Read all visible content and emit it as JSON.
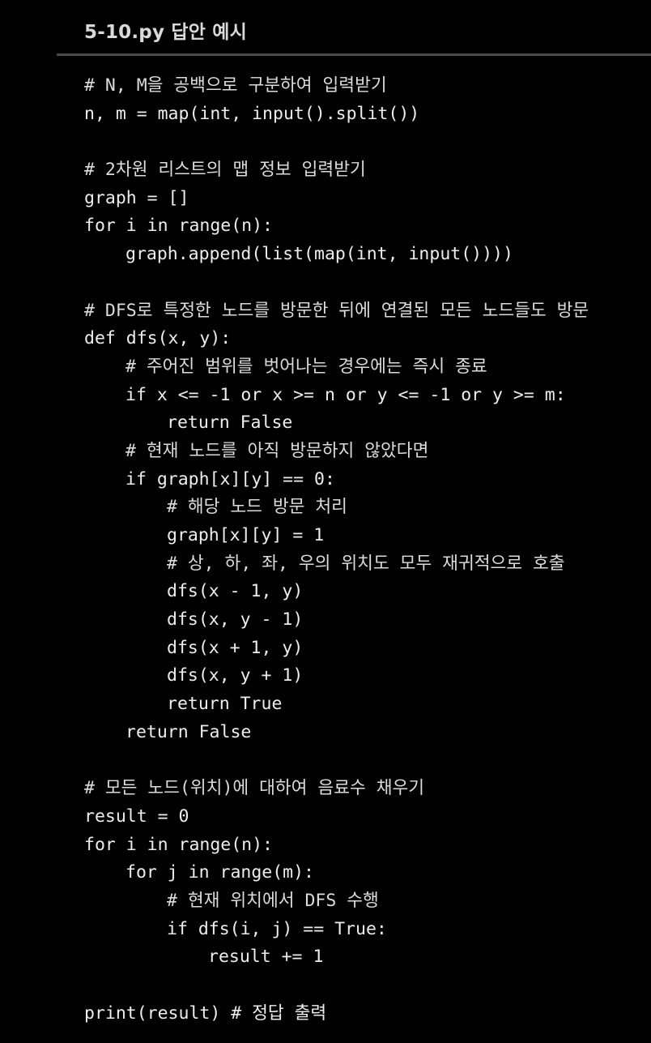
{
  "header": {
    "title": "5-10.py 답안 예시"
  },
  "code": {
    "lines": [
      {
        "indent": 0,
        "text": "# N, M을 공백으로 구분하여 입력받기"
      },
      {
        "indent": 0,
        "text": "n, m = map(int, input().split())"
      },
      {
        "indent": 0,
        "text": ""
      },
      {
        "indent": 0,
        "text": "# 2차원 리스트의 맵 정보 입력받기"
      },
      {
        "indent": 0,
        "text": "graph = []"
      },
      {
        "indent": 0,
        "text": "for i in range(n):"
      },
      {
        "indent": 1,
        "text": "graph.append(list(map(int, input())))"
      },
      {
        "indent": 0,
        "text": ""
      },
      {
        "indent": 0,
        "text": "# DFS로 특정한 노드를 방문한 뒤에 연결된 모든 노드들도 방문"
      },
      {
        "indent": 0,
        "text": "def dfs(x, y):"
      },
      {
        "indent": 1,
        "text": "# 주어진 범위를 벗어나는 경우에는 즉시 종료"
      },
      {
        "indent": 1,
        "text": "if x <= -1 or x >= n or y <= -1 or y >= m:"
      },
      {
        "indent": 2,
        "text": "return False"
      },
      {
        "indent": 1,
        "text": "# 현재 노드를 아직 방문하지 않았다면"
      },
      {
        "indent": 1,
        "text": "if graph[x][y] == 0:"
      },
      {
        "indent": 2,
        "text": "# 해당 노드 방문 처리"
      },
      {
        "indent": 2,
        "text": "graph[x][y] = 1"
      },
      {
        "indent": 2,
        "text": "# 상, 하, 좌, 우의 위치도 모두 재귀적으로 호출"
      },
      {
        "indent": 2,
        "text": "dfs(x - 1, y)"
      },
      {
        "indent": 2,
        "text": "dfs(x, y - 1)"
      },
      {
        "indent": 2,
        "text": "dfs(x + 1, y)"
      },
      {
        "indent": 2,
        "text": "dfs(x, y + 1)"
      },
      {
        "indent": 2,
        "text": "return True"
      },
      {
        "indent": 1,
        "text": "return False"
      },
      {
        "indent": 0,
        "text": ""
      },
      {
        "indent": 0,
        "text": "# 모든 노드(위치)에 대하여 음료수 채우기"
      },
      {
        "indent": 0,
        "text": "result = 0"
      },
      {
        "indent": 0,
        "text": "for i in range(n):"
      },
      {
        "indent": 1,
        "text": "for j in range(m):"
      },
      {
        "indent": 2,
        "text": "# 현재 위치에서 DFS 수행"
      },
      {
        "indent": 2,
        "text": "if dfs(i, j) == True:"
      },
      {
        "indent": 3,
        "text": "result += 1"
      },
      {
        "indent": 0,
        "text": ""
      },
      {
        "indent": 0,
        "text": "print(result) # 정답 출력"
      }
    ]
  }
}
